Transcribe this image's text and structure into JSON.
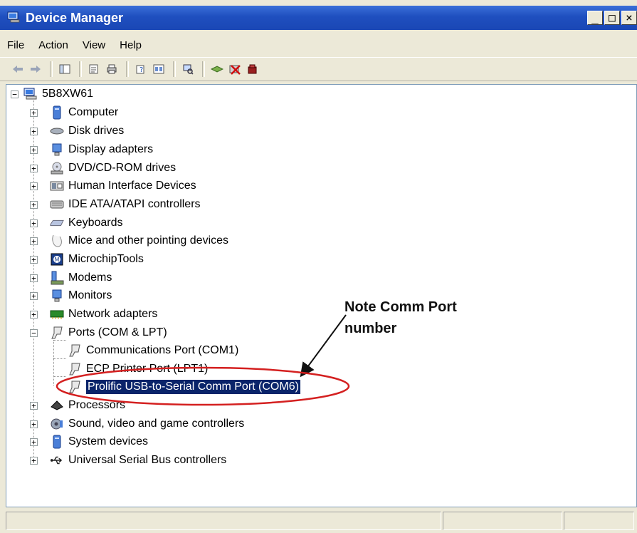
{
  "window": {
    "title": "Device Manager",
    "minimize": "_",
    "maximize": "□",
    "close": "×"
  },
  "menu": {
    "items": [
      "File",
      "Action",
      "View",
      "Help"
    ]
  },
  "toolbar": {
    "icons": [
      "back-icon",
      "forward-icon",
      "console-tree-icon",
      "properties-icon",
      "print-icon",
      "help-icon",
      "expand-icon",
      "scan-hardware-icon",
      "update-driver-icon",
      "disable-icon",
      "uninstall-icon"
    ]
  },
  "tree": {
    "root": "5B8XW61",
    "nodes": [
      {
        "label": "Computer",
        "icon": "computer-icon"
      },
      {
        "label": "Disk drives",
        "icon": "disk-drive-icon"
      },
      {
        "label": "Display adapters",
        "icon": "display-adapter-icon"
      },
      {
        "label": "DVD/CD-ROM drives",
        "icon": "dvd-drive-icon"
      },
      {
        "label": "Human Interface Devices",
        "icon": "hid-icon"
      },
      {
        "label": "IDE ATA/ATAPI controllers",
        "icon": "ide-controller-icon"
      },
      {
        "label": "Keyboards",
        "icon": "keyboard-icon"
      },
      {
        "label": "Mice and other pointing devices",
        "icon": "mouse-icon"
      },
      {
        "label": "MicrochipTools",
        "icon": "microchip-icon"
      },
      {
        "label": "Modems",
        "icon": "modem-icon"
      },
      {
        "label": "Monitors",
        "icon": "monitor-icon"
      },
      {
        "label": "Network adapters",
        "icon": "network-adapter-icon"
      },
      {
        "label": "Ports (COM & LPT)",
        "icon": "port-icon",
        "expanded": true
      },
      {
        "label": "Processors",
        "icon": "processor-icon"
      },
      {
        "label": "Sound, video and game controllers",
        "icon": "sound-icon"
      },
      {
        "label": "System devices",
        "icon": "system-device-icon"
      },
      {
        "label": "Universal Serial Bus controllers",
        "icon": "usb-icon"
      }
    ],
    "ports_children": [
      "Communications Port (COM1)",
      "ECP Printer Port (LPT1)",
      "Prolific USB-to-Serial Comm Port (COM6)"
    ]
  },
  "annotation": {
    "line1": "Note Comm Port",
    "line2": "number",
    "color": "#d42020"
  },
  "colors": {
    "titlebar": "#1f4fbf",
    "selection": "#0a246a"
  }
}
